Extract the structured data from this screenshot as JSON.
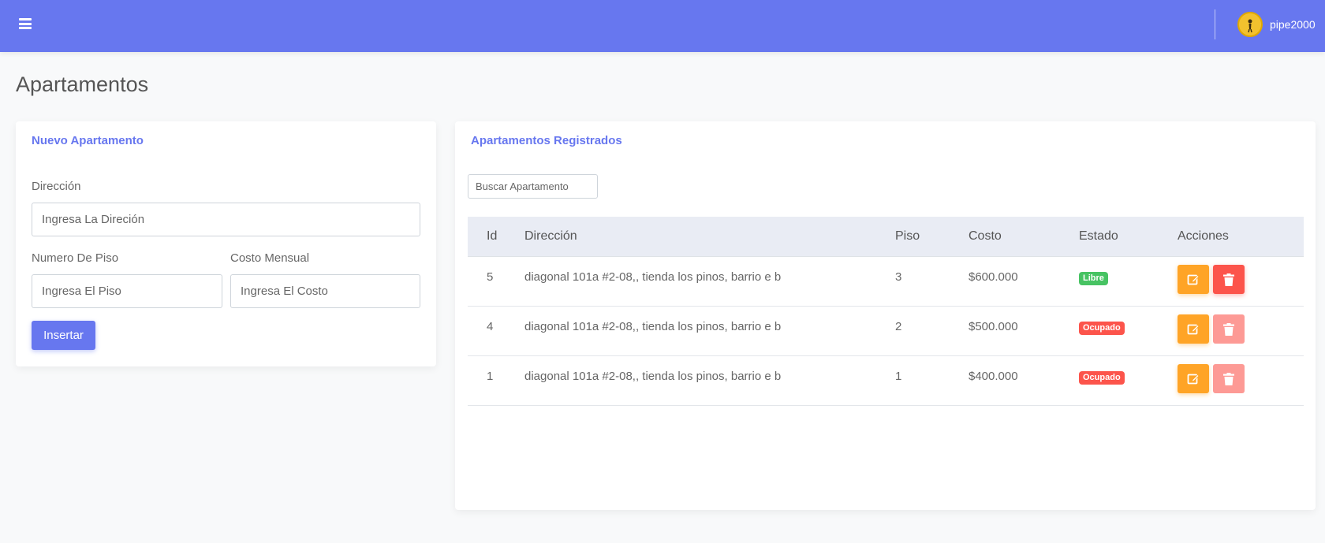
{
  "navbar": {
    "username": "pipe2000",
    "menu_icon": "hamburger-menu-icon",
    "avatar_icon": "user-avatar"
  },
  "page": {
    "title": "Apartamentos"
  },
  "form_card": {
    "title": "Nuevo Apartamento",
    "direccion_label": "Dirección",
    "direccion_placeholder": "Ingresa La Direción",
    "piso_label": "Numero De Piso",
    "piso_placeholder": "Ingresa El Piso",
    "costo_label": "Costo Mensual",
    "costo_placeholder": "Ingresa El Costo",
    "submit_label": "Insertar"
  },
  "list_card": {
    "title": "Apartamentos Registrados",
    "search_placeholder": "Buscar Apartamento",
    "columns": {
      "id": "Id",
      "direccion": "Dirección",
      "piso": "Piso",
      "costo": "Costo",
      "estado": "Estado",
      "acciones": "Acciones"
    },
    "rows": [
      {
        "id": "5",
        "direccion": "diagonal 101a #2-08,, tienda los pinos, barrio e b",
        "piso": "3",
        "costo": "$600.000",
        "estado": "Libre"
      },
      {
        "id": "4",
        "direccion": "diagonal 101a #2-08,, tienda los pinos, barrio e b",
        "piso": "2",
        "costo": "$500.000",
        "estado": "Ocupado"
      },
      {
        "id": "1",
        "direccion": "diagonal 101a #2-08,, tienda los pinos, barrio e b",
        "piso": "1",
        "costo": "$400.000",
        "estado": "Ocupado"
      }
    ]
  },
  "colors": {
    "primary": "#6777ef",
    "warning": "#ffa426",
    "danger": "#fc544b",
    "success": "#47c363"
  }
}
